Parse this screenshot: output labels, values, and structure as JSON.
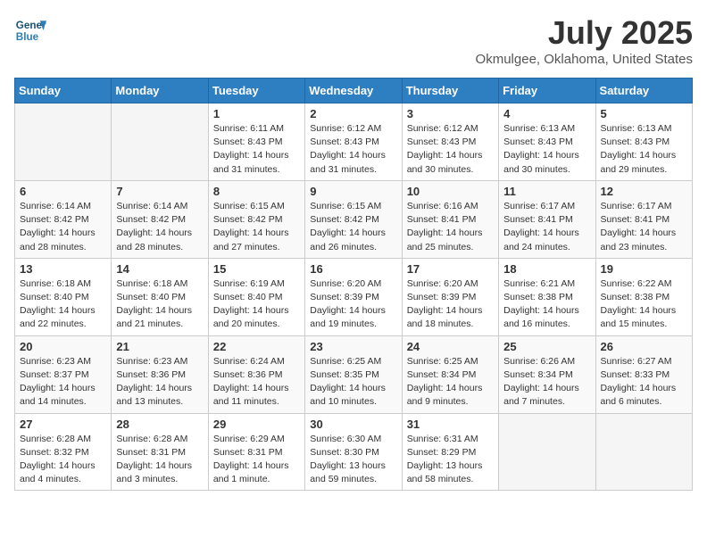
{
  "header": {
    "logo_line1": "General",
    "logo_line2": "Blue",
    "month": "July 2025",
    "location": "Okmulgee, Oklahoma, United States"
  },
  "days_of_week": [
    "Sunday",
    "Monday",
    "Tuesday",
    "Wednesday",
    "Thursday",
    "Friday",
    "Saturday"
  ],
  "weeks": [
    [
      {
        "day": "",
        "info": ""
      },
      {
        "day": "",
        "info": ""
      },
      {
        "day": "1",
        "info": "Sunrise: 6:11 AM\nSunset: 8:43 PM\nDaylight: 14 hours\nand 31 minutes."
      },
      {
        "day": "2",
        "info": "Sunrise: 6:12 AM\nSunset: 8:43 PM\nDaylight: 14 hours\nand 31 minutes."
      },
      {
        "day": "3",
        "info": "Sunrise: 6:12 AM\nSunset: 8:43 PM\nDaylight: 14 hours\nand 30 minutes."
      },
      {
        "day": "4",
        "info": "Sunrise: 6:13 AM\nSunset: 8:43 PM\nDaylight: 14 hours\nand 30 minutes."
      },
      {
        "day": "5",
        "info": "Sunrise: 6:13 AM\nSunset: 8:43 PM\nDaylight: 14 hours\nand 29 minutes."
      }
    ],
    [
      {
        "day": "6",
        "info": "Sunrise: 6:14 AM\nSunset: 8:42 PM\nDaylight: 14 hours\nand 28 minutes."
      },
      {
        "day": "7",
        "info": "Sunrise: 6:14 AM\nSunset: 8:42 PM\nDaylight: 14 hours\nand 28 minutes."
      },
      {
        "day": "8",
        "info": "Sunrise: 6:15 AM\nSunset: 8:42 PM\nDaylight: 14 hours\nand 27 minutes."
      },
      {
        "day": "9",
        "info": "Sunrise: 6:15 AM\nSunset: 8:42 PM\nDaylight: 14 hours\nand 26 minutes."
      },
      {
        "day": "10",
        "info": "Sunrise: 6:16 AM\nSunset: 8:41 PM\nDaylight: 14 hours\nand 25 minutes."
      },
      {
        "day": "11",
        "info": "Sunrise: 6:17 AM\nSunset: 8:41 PM\nDaylight: 14 hours\nand 24 minutes."
      },
      {
        "day": "12",
        "info": "Sunrise: 6:17 AM\nSunset: 8:41 PM\nDaylight: 14 hours\nand 23 minutes."
      }
    ],
    [
      {
        "day": "13",
        "info": "Sunrise: 6:18 AM\nSunset: 8:40 PM\nDaylight: 14 hours\nand 22 minutes."
      },
      {
        "day": "14",
        "info": "Sunrise: 6:18 AM\nSunset: 8:40 PM\nDaylight: 14 hours\nand 21 minutes."
      },
      {
        "day": "15",
        "info": "Sunrise: 6:19 AM\nSunset: 8:40 PM\nDaylight: 14 hours\nand 20 minutes."
      },
      {
        "day": "16",
        "info": "Sunrise: 6:20 AM\nSunset: 8:39 PM\nDaylight: 14 hours\nand 19 minutes."
      },
      {
        "day": "17",
        "info": "Sunrise: 6:20 AM\nSunset: 8:39 PM\nDaylight: 14 hours\nand 18 minutes."
      },
      {
        "day": "18",
        "info": "Sunrise: 6:21 AM\nSunset: 8:38 PM\nDaylight: 14 hours\nand 16 minutes."
      },
      {
        "day": "19",
        "info": "Sunrise: 6:22 AM\nSunset: 8:38 PM\nDaylight: 14 hours\nand 15 minutes."
      }
    ],
    [
      {
        "day": "20",
        "info": "Sunrise: 6:23 AM\nSunset: 8:37 PM\nDaylight: 14 hours\nand 14 minutes."
      },
      {
        "day": "21",
        "info": "Sunrise: 6:23 AM\nSunset: 8:36 PM\nDaylight: 14 hours\nand 13 minutes."
      },
      {
        "day": "22",
        "info": "Sunrise: 6:24 AM\nSunset: 8:36 PM\nDaylight: 14 hours\nand 11 minutes."
      },
      {
        "day": "23",
        "info": "Sunrise: 6:25 AM\nSunset: 8:35 PM\nDaylight: 14 hours\nand 10 minutes."
      },
      {
        "day": "24",
        "info": "Sunrise: 6:25 AM\nSunset: 8:34 PM\nDaylight: 14 hours\nand 9 minutes."
      },
      {
        "day": "25",
        "info": "Sunrise: 6:26 AM\nSunset: 8:34 PM\nDaylight: 14 hours\nand 7 minutes."
      },
      {
        "day": "26",
        "info": "Sunrise: 6:27 AM\nSunset: 8:33 PM\nDaylight: 14 hours\nand 6 minutes."
      }
    ],
    [
      {
        "day": "27",
        "info": "Sunrise: 6:28 AM\nSunset: 8:32 PM\nDaylight: 14 hours\nand 4 minutes."
      },
      {
        "day": "28",
        "info": "Sunrise: 6:28 AM\nSunset: 8:31 PM\nDaylight: 14 hours\nand 3 minutes."
      },
      {
        "day": "29",
        "info": "Sunrise: 6:29 AM\nSunset: 8:31 PM\nDaylight: 14 hours\nand 1 minute."
      },
      {
        "day": "30",
        "info": "Sunrise: 6:30 AM\nSunset: 8:30 PM\nDaylight: 13 hours\nand 59 minutes."
      },
      {
        "day": "31",
        "info": "Sunrise: 6:31 AM\nSunset: 8:29 PM\nDaylight: 13 hours\nand 58 minutes."
      },
      {
        "day": "",
        "info": ""
      },
      {
        "day": "",
        "info": ""
      }
    ]
  ]
}
